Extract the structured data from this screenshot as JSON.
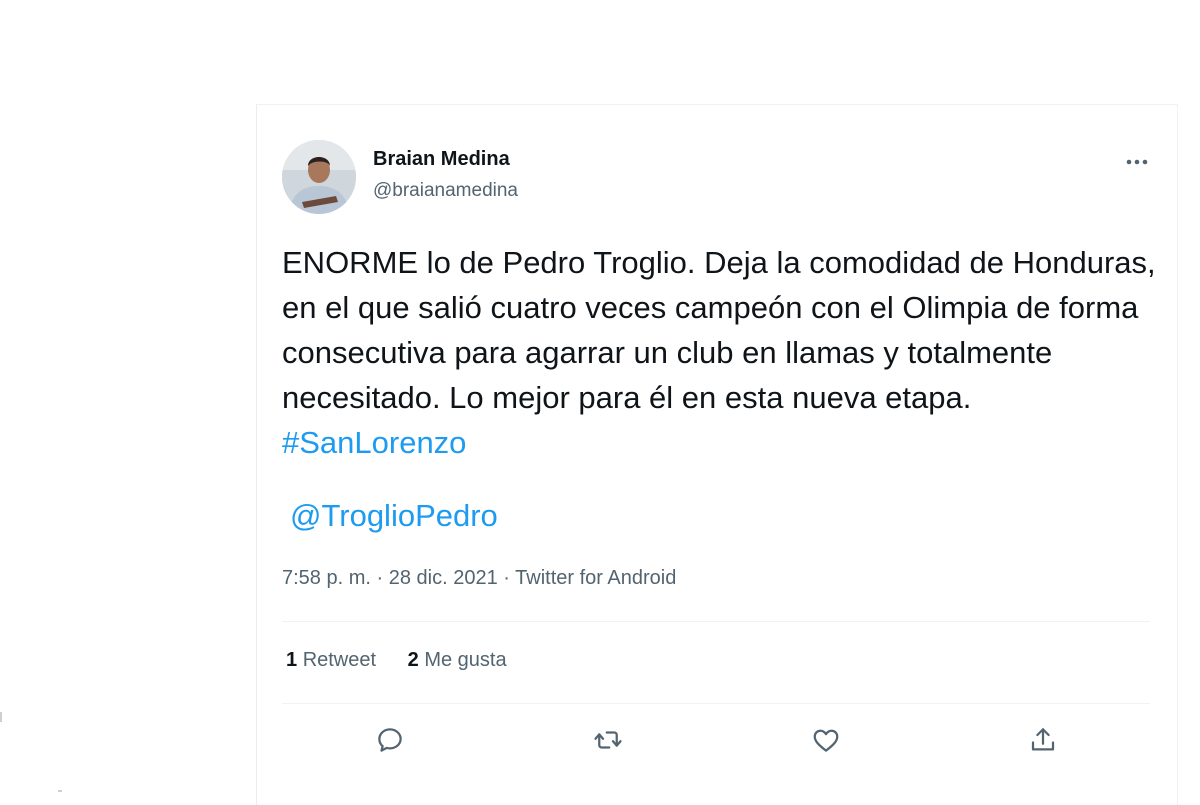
{
  "tweet": {
    "author_name": "Braian Medina",
    "author_handle": "@braianamedina",
    "text_main": "ENORME lo de Pedro Troglio. Deja la comodidad de Honduras, en el que salió cuatro veces campeón con el Olimpia de forma consecutiva para agarrar un club en llamas y totalmente necesitado. Lo mejor para él en esta nueva etapa. ",
    "hashtag": "#SanLorenzo",
    "mention": "@TroglioPedro",
    "time": "7:58 p. m.",
    "date": "28 dic. 2021",
    "separator": "·",
    "source": "Twitter for Android",
    "retweets_count": "1",
    "retweets_label": "Retweet",
    "likes_count": "2",
    "likes_label": "Me gusta",
    "more_glyph": "···"
  },
  "colors": {
    "accent": "#1d9bf0",
    "text_primary": "#0f1419",
    "text_secondary": "#536471",
    "divider": "#eff3f4"
  },
  "icons": [
    "more-options-icon",
    "reply-icon",
    "retweet-icon",
    "like-icon",
    "share-icon"
  ]
}
